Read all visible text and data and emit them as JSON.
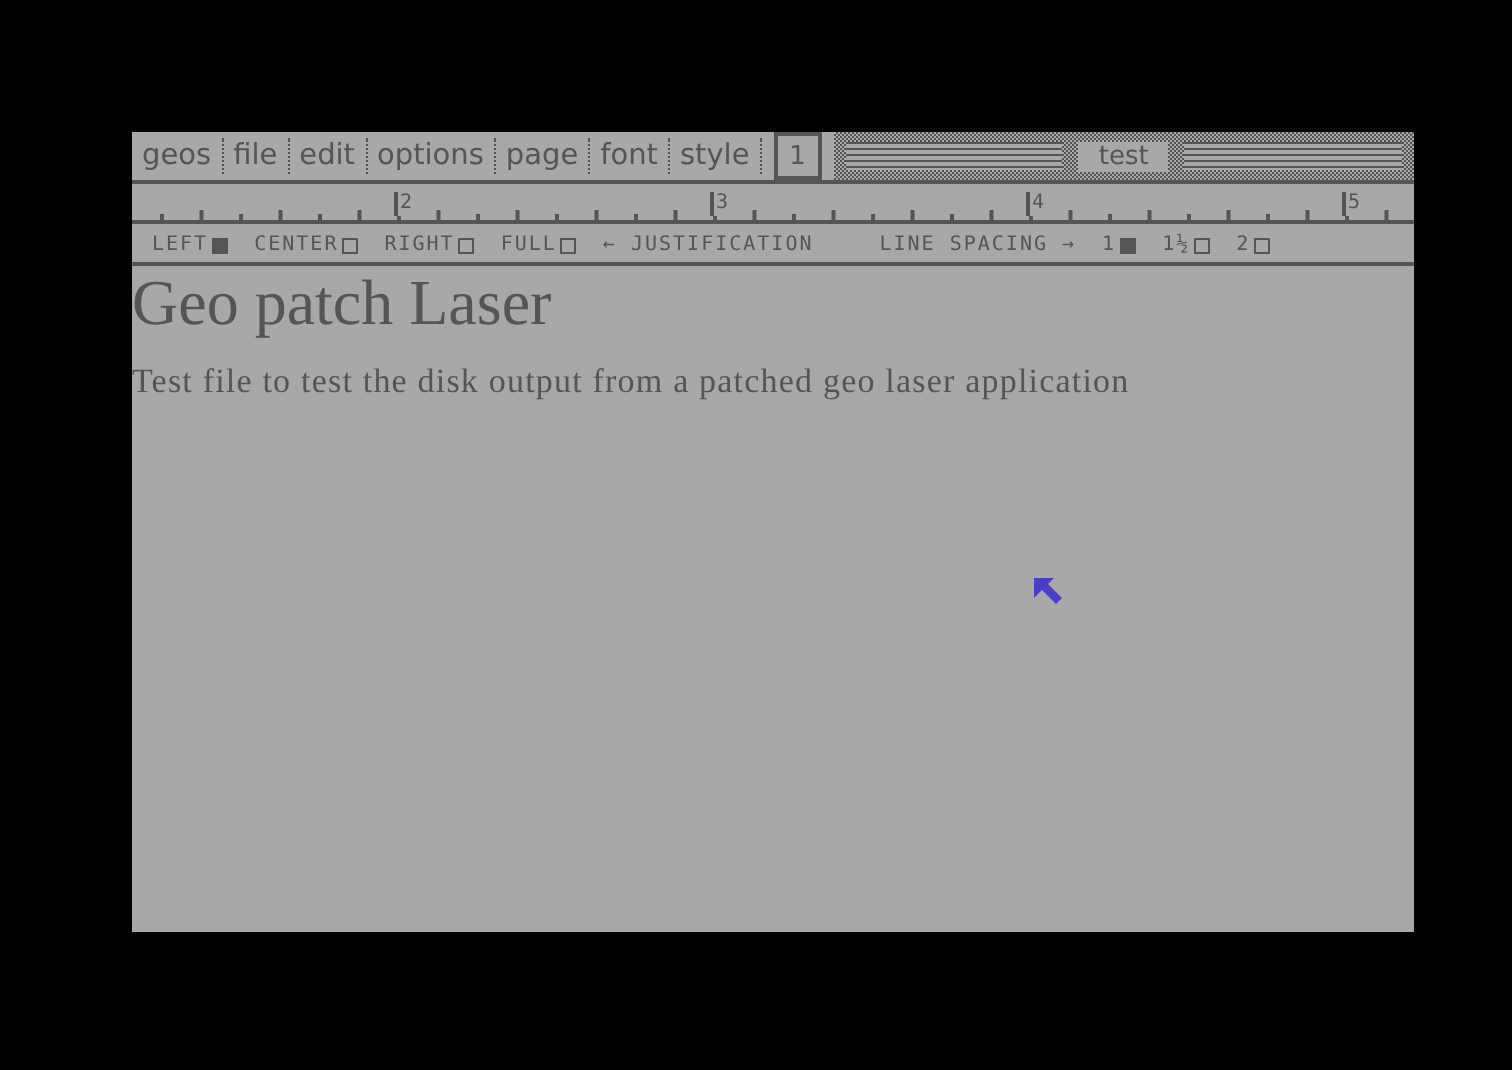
{
  "menu": [
    {
      "label": "geos"
    },
    {
      "label": "file"
    },
    {
      "label": "edit"
    },
    {
      "label": "options"
    },
    {
      "label": "page"
    },
    {
      "label": "font"
    },
    {
      "label": "style"
    }
  ],
  "page_number": "1",
  "document_title": "test",
  "ruler_labels": [
    "2",
    "3",
    "4",
    "5"
  ],
  "justification": [
    {
      "label": "LEFT",
      "selected": true
    },
    {
      "label": "CENTER",
      "selected": false
    },
    {
      "label": "RIGHT",
      "selected": false
    },
    {
      "label": "FULL",
      "selected": false
    }
  ],
  "justification_label": "← JUSTIFICATION",
  "line_spacing_label": "LINE SPACING →",
  "line_spacing": [
    {
      "label": "1",
      "selected": true
    },
    {
      "label": "1½",
      "selected": false
    },
    {
      "label": "2",
      "selected": false
    }
  ],
  "document": {
    "heading": "Geo patch Laser",
    "body": "Test file to test the disk output from a patched geo laser application"
  }
}
